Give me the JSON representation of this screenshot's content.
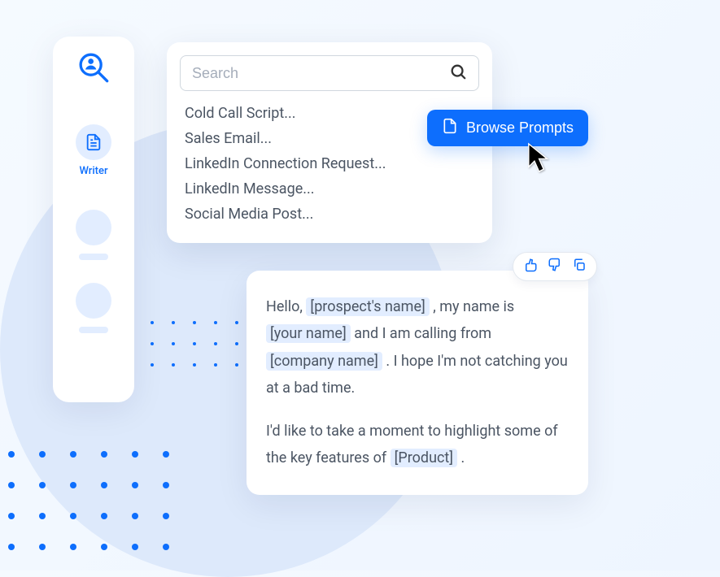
{
  "sidebar": {
    "items": [
      {
        "label": "Writer"
      }
    ]
  },
  "search": {
    "placeholder": "Search"
  },
  "prompts": {
    "items": [
      "Cold Call Script...",
      "Sales Email...",
      "LinkedIn Connection Request...",
      "LinkedIn Message...",
      "Social Media Post..."
    ]
  },
  "browse_button": {
    "label": "Browse Prompts"
  },
  "output": {
    "tokens": {
      "prospect_name": "[prospect's name]",
      "your_name": "[your name]",
      "company_name": "[company name]",
      "product": "[Product]"
    },
    "text": {
      "t1": "Hello, ",
      "t2": " , my name is ",
      "t3": "  and I am calling from ",
      "t4": " . I hope I'm not catching you at a bad time.",
      "t5": "I'd like to take a moment to highlight some of the key features of ",
      "t6": " ."
    }
  }
}
